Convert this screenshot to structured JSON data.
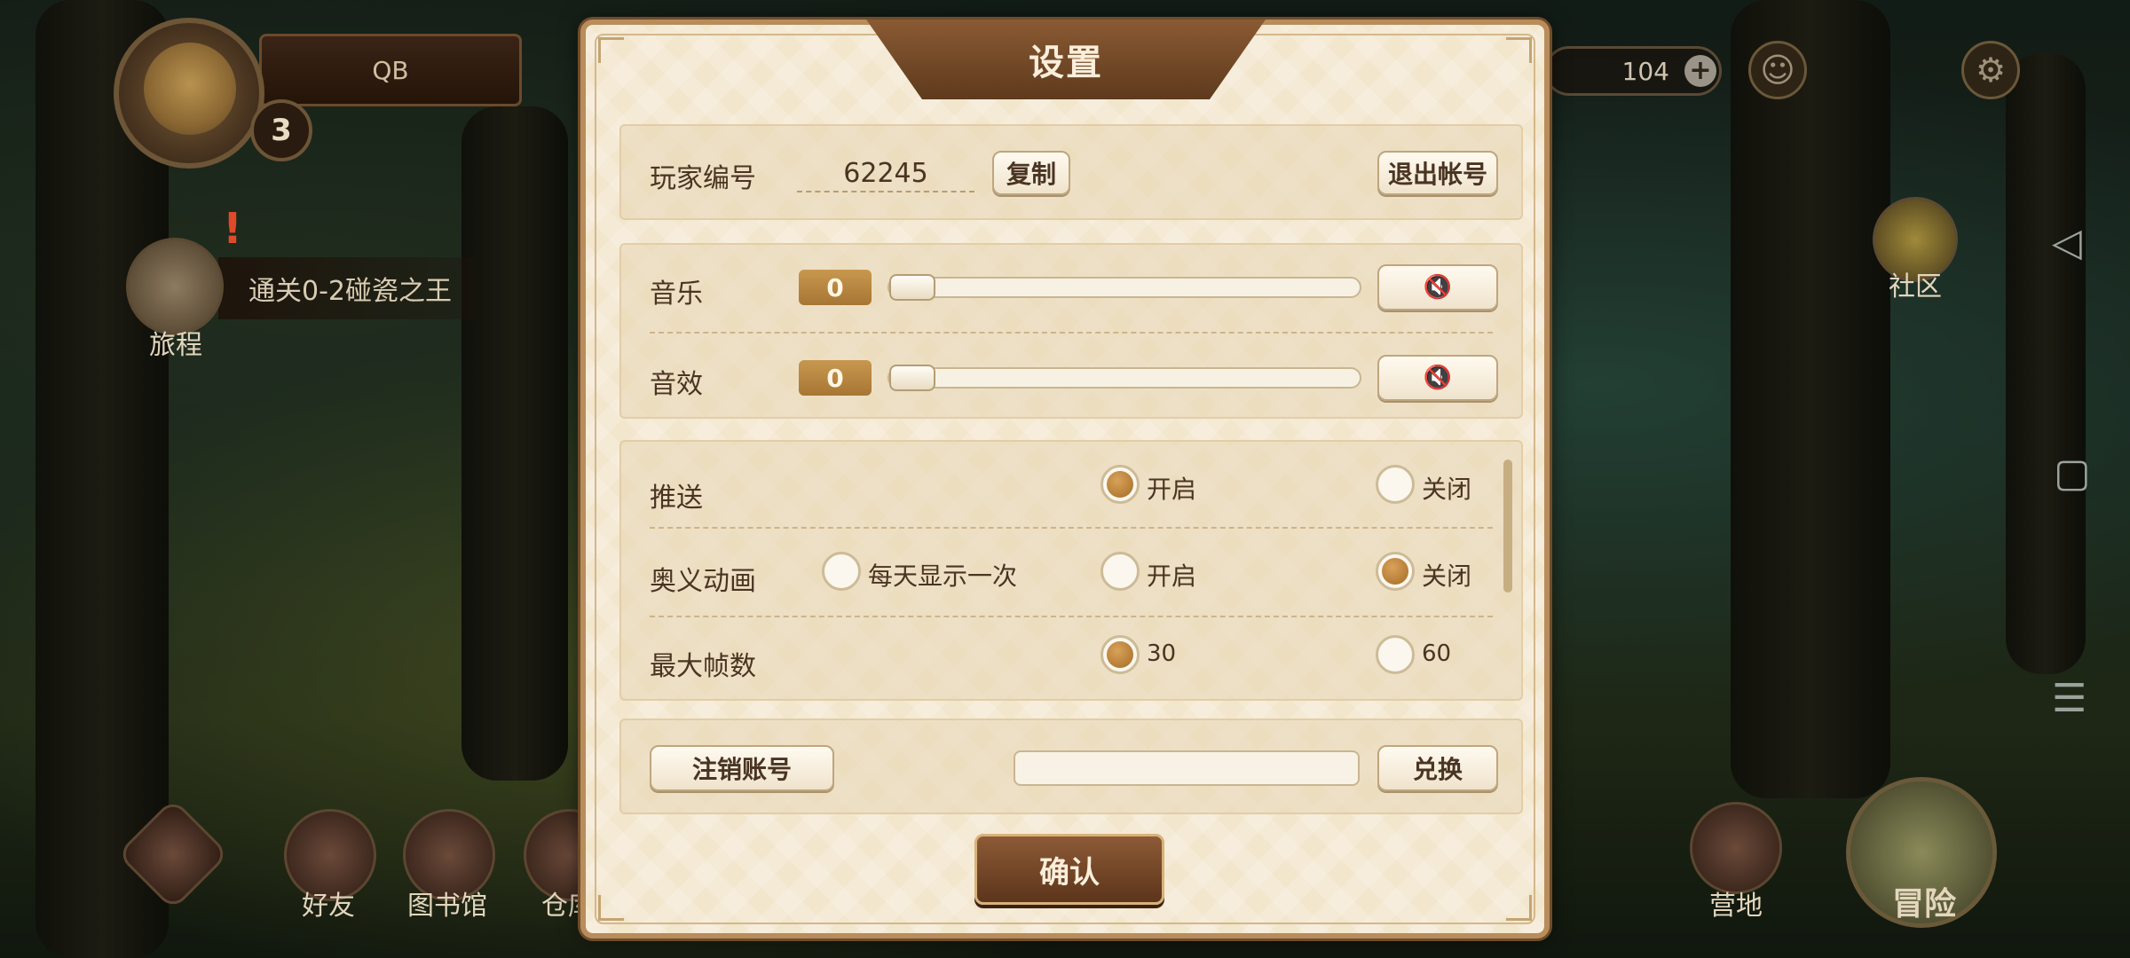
{
  "hud": {
    "player_name": "QB",
    "level": "3",
    "quest_text": "通关0-2碰瓷之王",
    "quest_label": "旅程",
    "currency_amount": "104",
    "community_label": "社区",
    "bottom_nav": {
      "friends": "好友",
      "library": "图书馆",
      "warehouse": "仓库",
      "camp": "营地",
      "adventure": "冒险"
    }
  },
  "settings": {
    "title": "设置",
    "account": {
      "player_id_label": "玩家编号",
      "player_id_value": "62245",
      "copy_button": "复制",
      "logout_button": "退出帐号"
    },
    "audio": {
      "music_label": "音乐",
      "music_value": "0",
      "music_level": 0,
      "sfx_label": "音效",
      "sfx_value": "0",
      "sfx_level": 0,
      "mute_icon": "speaker-mute-icon"
    },
    "options": {
      "push_label": "推送",
      "push_on": "开启",
      "push_off": "关闭",
      "push_selected": "开启",
      "ultimate_label": "奥义动画",
      "ultimate_daily": "每天显示一次",
      "ultimate_on": "开启",
      "ultimate_off": "关闭",
      "ultimate_selected": "关闭",
      "fps_label": "最大帧数",
      "fps_30": "30",
      "fps_60": "60",
      "fps_selected": "30"
    },
    "code": {
      "delete_account_button": "注销账号",
      "redeem_input_value": "",
      "redeem_button": "兑换"
    },
    "confirm_button": "确认"
  },
  "colors": {
    "accent_brown": "#5e3a1d",
    "radio_selected": "#c08030",
    "panel_bg": "#f2e6cd"
  }
}
